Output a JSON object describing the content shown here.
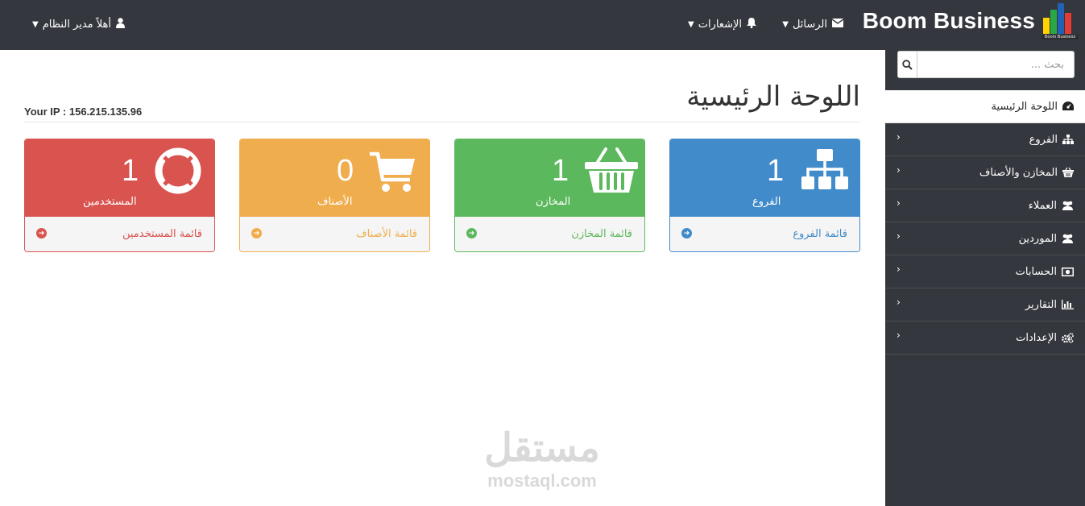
{
  "brand": {
    "name": "Boom Business",
    "logo_caption": "Boom Business",
    "logo_bars": [
      "#ffd200",
      "#29a745",
      "#1f62b8",
      "#e53935"
    ]
  },
  "topnav": {
    "user": "أهلاً مدير النظام",
    "notifications": "الإشعارات",
    "messages": "الرسائل"
  },
  "search": {
    "placeholder": "بحث ..."
  },
  "sidebar": {
    "items": [
      {
        "label": "اللوحة الرئيسية",
        "icon": "dashboard-icon",
        "active": true
      },
      {
        "label": "الفروع",
        "icon": "sitemap-icon"
      },
      {
        "label": "المخازن والأصناف",
        "icon": "basket-icon"
      },
      {
        "label": "العملاء",
        "icon": "users-icon"
      },
      {
        "label": "الموردين",
        "icon": "users-icon"
      },
      {
        "label": "الحسابات",
        "icon": "money-icon"
      },
      {
        "label": "التقارير",
        "icon": "bar-chart-icon"
      },
      {
        "label": "الإعدادات",
        "icon": "cogs-icon"
      }
    ]
  },
  "main": {
    "title": "اللوحة الرئيسية",
    "ip": "Your IP : 156.215.135.96"
  },
  "cards": [
    {
      "count": "1",
      "label": "الفروع",
      "link": "قائمة الفروع",
      "icon": "sitemap-icon",
      "color": "#428bca"
    },
    {
      "count": "1",
      "label": "المخازن",
      "link": "قائمة المخازن",
      "icon": "basket-icon",
      "color": "#5cb85c"
    },
    {
      "count": "0",
      "label": "الأصناف",
      "link": "قائمة الأصناف",
      "icon": "cart-icon",
      "color": "#f0ad4e"
    },
    {
      "count": "1",
      "label": "المستخدمين",
      "link": "قائمة المستخدمين",
      "icon": "life-ring-icon",
      "color": "#d9534f"
    }
  ],
  "watermark": {
    "arabic": "مستقل",
    "latin": "mostaql.com"
  }
}
